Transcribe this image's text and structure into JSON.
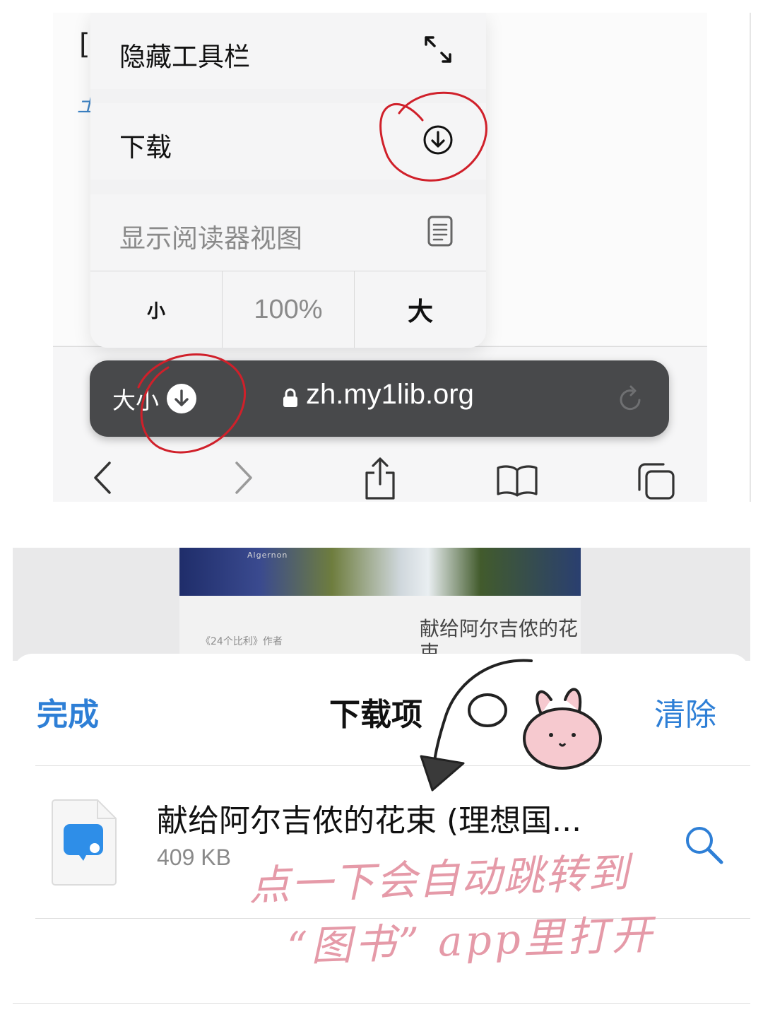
{
  "top": {
    "page_corner_char": "[",
    "page_corner_link": "土",
    "menu": {
      "hide_toolbar": "隐藏工具栏",
      "download": "下载",
      "reader_view": "显示阅读器视图",
      "zoom_small": "小",
      "zoom_level": "100%",
      "zoom_large": "大"
    },
    "address_bar": {
      "size_label": "大小",
      "url": "zh.my1lib.org"
    },
    "icons": {
      "hide_toolbar": "expand-arrows-icon",
      "download": "download-circle-icon",
      "reader": "reader-document-icon",
      "lock": "lock-icon",
      "reload": "reload-icon",
      "back": "chevron-left-icon",
      "forward": "chevron-right-icon",
      "share": "share-icon",
      "bookmarks": "book-icon",
      "tabs": "tabs-icon"
    }
  },
  "bottom": {
    "book": {
      "art_text": "Algernon",
      "author_line": "《24个比利》作者",
      "title": "献给阿尔吉侬的花束"
    },
    "sheet": {
      "done": "完成",
      "title": "下载项",
      "clear": "清除"
    },
    "file": {
      "name": "献给阿尔吉侬的花束 (理想国...",
      "size": "409 KB"
    }
  },
  "annotation": {
    "line1": "点一下会自动跳转到",
    "line2": "“图书” app里打开",
    "color": "#e59aa8",
    "circle_color": "#d0202a"
  }
}
